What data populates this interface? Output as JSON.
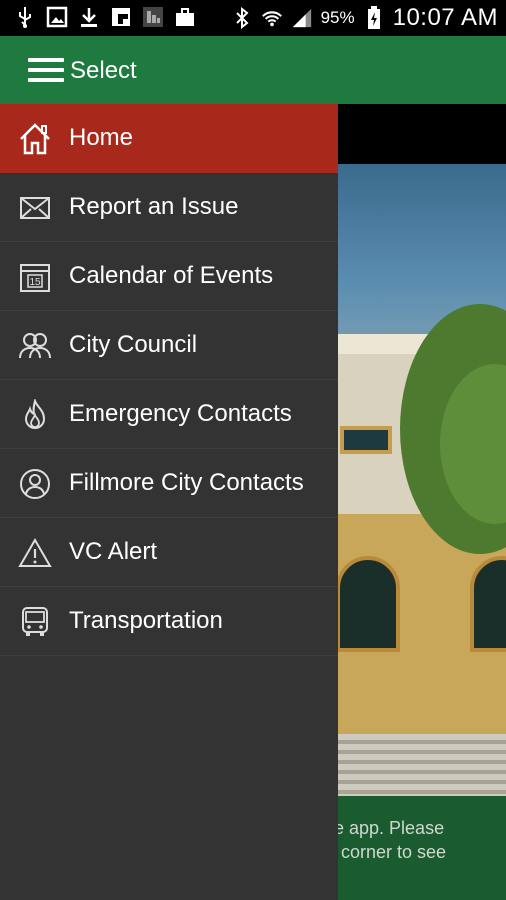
{
  "status_bar": {
    "icons": [
      "usb-icon",
      "image-icon",
      "download-icon",
      "flipboard-icon",
      "app-notification-icon",
      "briefcase-icon",
      "bluetooth-icon",
      "wifi-icon",
      "signal-icon",
      "battery-icon"
    ],
    "battery": "95%",
    "time": "10:07 AM"
  },
  "action_bar": {
    "title": "Select",
    "background": "#1f7a3f"
  },
  "drawer": {
    "items": [
      {
        "label": "Home",
        "icon": "home-icon",
        "active": true
      },
      {
        "label": "Report an Issue",
        "icon": "envelope-icon"
      },
      {
        "label": "Calendar of Events",
        "icon": "calendar-icon",
        "calendar_day": "15"
      },
      {
        "label": "City Council",
        "icon": "group-icon"
      },
      {
        "label": "Emergency Contacts",
        "icon": "flame-icon"
      },
      {
        "label": "Fillmore City Contacts",
        "icon": "person-circle-icon"
      },
      {
        "label": "VC Alert",
        "icon": "warning-icon"
      },
      {
        "label": "Transportation",
        "icon": "bus-icon"
      }
    ],
    "active_color": "#a8291c",
    "background": "#333333"
  },
  "background_content": {
    "footer_text": "ile app. Please\nft corner to see"
  }
}
